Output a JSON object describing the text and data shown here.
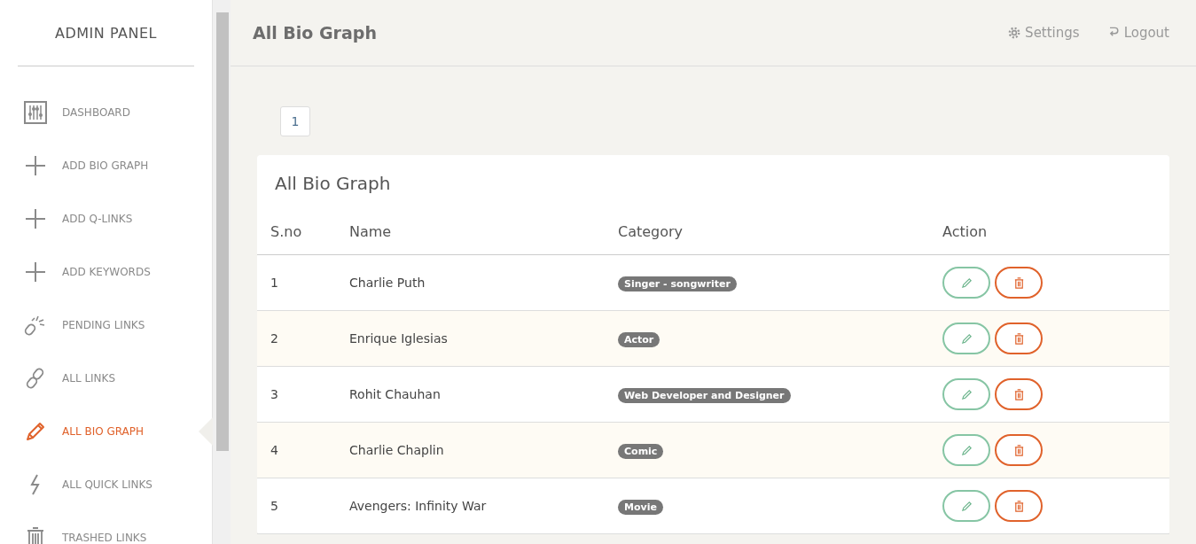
{
  "sidebar": {
    "title": "ADMIN PANEL",
    "items": [
      {
        "label": "DASHBOARD",
        "kind": "sliders",
        "selected": false
      },
      {
        "label": "ADD BIO GRAPH",
        "kind": "plus",
        "selected": false
      },
      {
        "label": "ADD Q-LINKS",
        "kind": "plus",
        "selected": false
      },
      {
        "label": "ADD KEYWORDS",
        "kind": "plus",
        "selected": false
      },
      {
        "label": "PENDING LINKS",
        "kind": "broken-link",
        "selected": false
      },
      {
        "label": "ALL LINKS",
        "kind": "link",
        "selected": false
      },
      {
        "label": "ALL BIO GRAPH",
        "kind": "pencil",
        "selected": true
      },
      {
        "label": "ALL QUICK LINKS",
        "kind": "bolt",
        "selected": false
      },
      {
        "label": "TRASHED LINKS",
        "kind": "trash",
        "selected": false
      }
    ]
  },
  "header": {
    "title": "All Bio Graph",
    "settings": "Settings",
    "logout": "Logout"
  },
  "pagination": [
    {
      "label": "1",
      "selected": false
    }
  ],
  "table": {
    "title": "All Bio Graph",
    "columns": [
      "S.no",
      "Name",
      "Category",
      "Action"
    ],
    "rows": [
      {
        "sno": "1",
        "name": "Charlie Puth",
        "category": "Singer - songwriter"
      },
      {
        "sno": "2",
        "name": "Enrique Iglesias",
        "category": "Actor"
      },
      {
        "sno": "3",
        "name": "Rohit Chauhan",
        "category": "Web Developer and Designer"
      },
      {
        "sno": "4",
        "name": "Charlie Chaplin",
        "category": "Comic"
      },
      {
        "sno": "5",
        "name": "Avengers: Infinity War",
        "category": "Movie"
      }
    ]
  }
}
